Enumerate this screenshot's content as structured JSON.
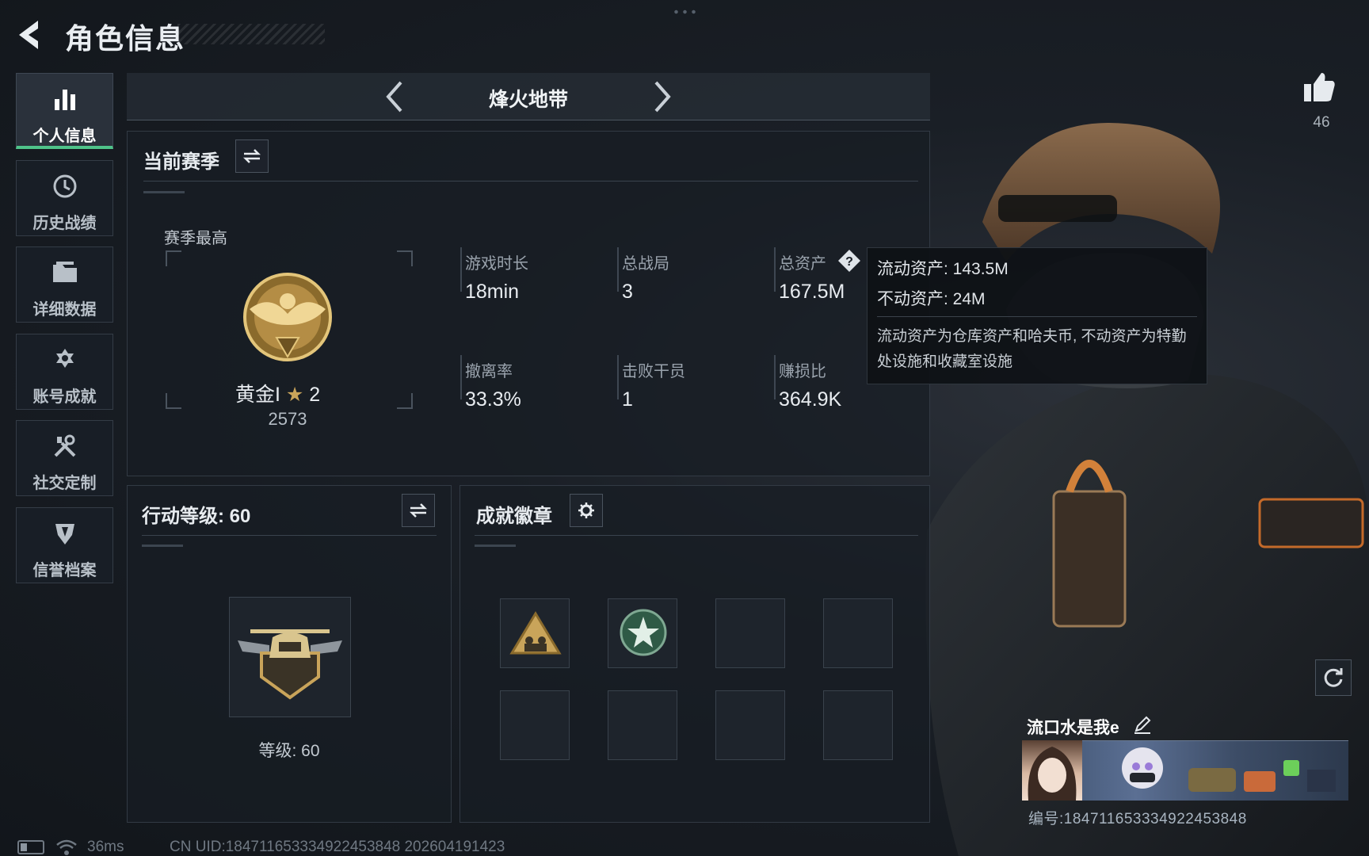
{
  "header": {
    "title": "角色信息"
  },
  "sidebar": {
    "items": [
      {
        "label": "个人信息",
        "icon": "bar-chart-icon",
        "active": true
      },
      {
        "label": "历史战绩",
        "icon": "history-clock-icon",
        "active": false
      },
      {
        "label": "详细数据",
        "icon": "folder-icon",
        "active": false
      },
      {
        "label": "账号成就",
        "icon": "medal-icon",
        "active": false
      },
      {
        "label": "社交定制",
        "icon": "tools-icon",
        "active": false
      },
      {
        "label": "信誉档案",
        "icon": "shield-icon",
        "active": false
      }
    ]
  },
  "mode": {
    "title": "烽火地带"
  },
  "season": {
    "title": "当前赛季",
    "best_label": "赛季最高",
    "rank_name": "黄金I",
    "rank_stars": "2",
    "rank_score": "2573",
    "stats": [
      {
        "label": "游戏时长",
        "value": "18min"
      },
      {
        "label": "总战局",
        "value": "3"
      },
      {
        "label": "总资产",
        "value": "167.5M"
      },
      {
        "label": "撤离率",
        "value": "33.3%"
      },
      {
        "label": "击败干员",
        "value": "1"
      },
      {
        "label": "赚损比",
        "value": "364.9K"
      }
    ]
  },
  "action_level": {
    "title": "行动等级: 60",
    "level_text": "等级: 60"
  },
  "badges": {
    "title": "成就徽章",
    "slots": [
      {
        "icon": "triangle-squad-badge-icon"
      },
      {
        "icon": "green-star-badge-icon"
      },
      {
        "icon": ""
      },
      {
        "icon": ""
      },
      {
        "icon": ""
      },
      {
        "icon": ""
      },
      {
        "icon": ""
      },
      {
        "icon": ""
      }
    ]
  },
  "tooltip": {
    "liquid": "流动资产: 143.5M",
    "fixed": "不动资产: 24M",
    "desc": "流动资产为仓库资产和哈夫币, 不动资产为特勤处设施和收藏室设施"
  },
  "likes": {
    "count": "46"
  },
  "player": {
    "name": "流口水是我e",
    "card_uid": "编号:18471165333492245384​8"
  },
  "status_bar": {
    "ping": "36ms",
    "uid_line": "CN UID:18471165333492245384​8 202604191423"
  },
  "colors": {
    "accent_green": "#4fc38a",
    "gold": "#c9a45a"
  }
}
